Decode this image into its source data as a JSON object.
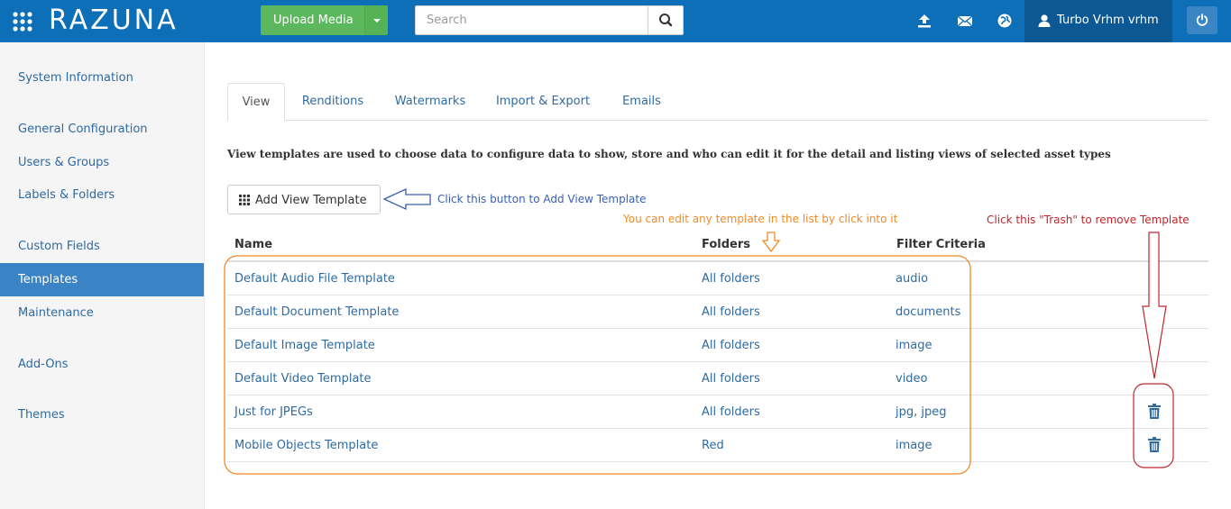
{
  "header": {
    "logo": "RAZUNA",
    "upload_label": "Upload Media",
    "search_placeholder": "Search",
    "user_name": "Turbo Vrhm vrhm",
    "icons": [
      "apps-grid-icon",
      "upload-icon",
      "mail-icon",
      "globe-icon",
      "user-icon",
      "power-icon",
      "search-icon"
    ]
  },
  "sidebar": {
    "items": [
      {
        "label": "System Information",
        "active": false
      },
      {
        "label": "General Configuration",
        "active": false
      },
      {
        "label": "Users & Groups",
        "active": false
      },
      {
        "label": "Labels & Folders",
        "active": false
      },
      {
        "label": "Custom Fields",
        "active": false
      },
      {
        "label": "Templates",
        "active": true
      },
      {
        "label": "Maintenance",
        "active": false
      },
      {
        "label": "Add-Ons",
        "active": false
      },
      {
        "label": "Themes",
        "active": false
      }
    ]
  },
  "tabs": [
    {
      "label": "View",
      "active": true
    },
    {
      "label": "Renditions",
      "active": false
    },
    {
      "label": "Watermarks",
      "active": false
    },
    {
      "label": "Import & Export",
      "active": false
    },
    {
      "label": "Emails",
      "active": false
    }
  ],
  "description": "View templates are used to choose data to configure data to show, store and who can edit it for the detail and listing views of selected asset types",
  "add_button_label": "Add View Template",
  "annotations": {
    "add_hint": "Click this button to Add View Template",
    "edit_hint": "You can edit any template in the list by click into it",
    "trash_hint": "Click this \"Trash\" to remove Template"
  },
  "table": {
    "headers": {
      "name": "Name",
      "folders": "Folders",
      "filter": "Filter Criteria"
    },
    "rows": [
      {
        "name": "Default Audio File Template",
        "folders": "All folders",
        "filter": "audio",
        "deletable": false
      },
      {
        "name": "Default Document Template",
        "folders": "All folders",
        "filter": "documents",
        "deletable": false
      },
      {
        "name": "Default Image Template",
        "folders": "All folders",
        "filter": "image",
        "deletable": false
      },
      {
        "name": "Default Video Template",
        "folders": "All folders",
        "filter": "video",
        "deletable": false
      },
      {
        "name": "Just for JPEGs",
        "folders": "All folders",
        "filter": "jpg, jpeg",
        "deletable": true
      },
      {
        "name": "Mobile Objects Template",
        "folders": "Red",
        "filter": "image",
        "deletable": true
      }
    ]
  },
  "colors": {
    "topbar": "#0d6fb8",
    "upload_button": "#5cb85c",
    "active_sidebar": "#3a84c6",
    "link": "#2f6aa0",
    "annotation_blue": "#3a5fb0",
    "annotation_orange": "#f08a24",
    "annotation_red": "#c0272d"
  }
}
